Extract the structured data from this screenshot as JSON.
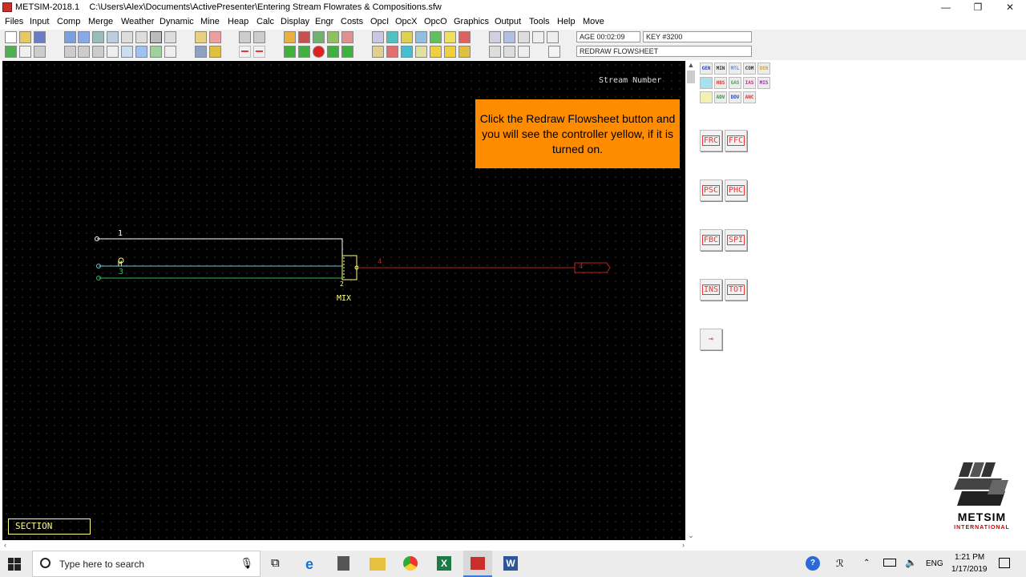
{
  "window": {
    "app": "METSIM-2018.1",
    "path": "C:\\Users\\Alex\\Documents\\ActivePresenter\\Entering Stream Flowrates & Compositions.sfw",
    "minimize": "—",
    "maximize": "❐",
    "close": "✕"
  },
  "menu": [
    "Files",
    "Input",
    "Comp",
    "Merge",
    "Weather",
    "Dynamic",
    "Mine",
    "Heap",
    "Calc",
    "Display",
    "Engr",
    "Costs",
    "OpcI",
    "OpcX",
    "OpcO",
    "Graphics",
    "Output",
    "Tools",
    "Help",
    "Move"
  ],
  "status": {
    "age": "AGE 00:02:09",
    "key": "KEY #3200",
    "command": "REDRAW FLOWSHEET"
  },
  "canvas": {
    "stream_number_label": "Stream Number",
    "callout": "Click the Redraw Flowsheet button and you will see the controller yellow, if it is turned on.",
    "unit_label": "MIX",
    "section_label": "SECTION",
    "streams": {
      "s1": "1",
      "s3": "3",
      "s2": "2",
      "s4": "4",
      "s4_end": "4"
    },
    "controller_mark": "M",
    "colors": {
      "stream1": "#ffffff",
      "stream2": "#66ccdd",
      "stream3": "#33bb55",
      "stream4": "#bb2222",
      "unit": "#ffff80",
      "callout": "#ff8c00"
    }
  },
  "palette": {
    "small_row1": [
      "GEN",
      "MIN",
      "MTL",
      "COM",
      "DEN"
    ],
    "small_row2": [
      "",
      "HBS",
      "GAS",
      "IAS",
      "MIS"
    ],
    "small_row3": [
      "",
      "ADV",
      "DDV",
      "ANC"
    ],
    "controllers": [
      "FRC",
      "FFC",
      "PSC",
      "PHC",
      "FBC",
      "SPI",
      "INS",
      "TOT"
    ]
  },
  "logo": {
    "name": "METSIM",
    "sub": "INTERNATIONAL"
  },
  "taskbar": {
    "search_placeholder": "Type here to search",
    "language": "ENG",
    "time": "1:21 PM",
    "date": "1/17/2019"
  }
}
